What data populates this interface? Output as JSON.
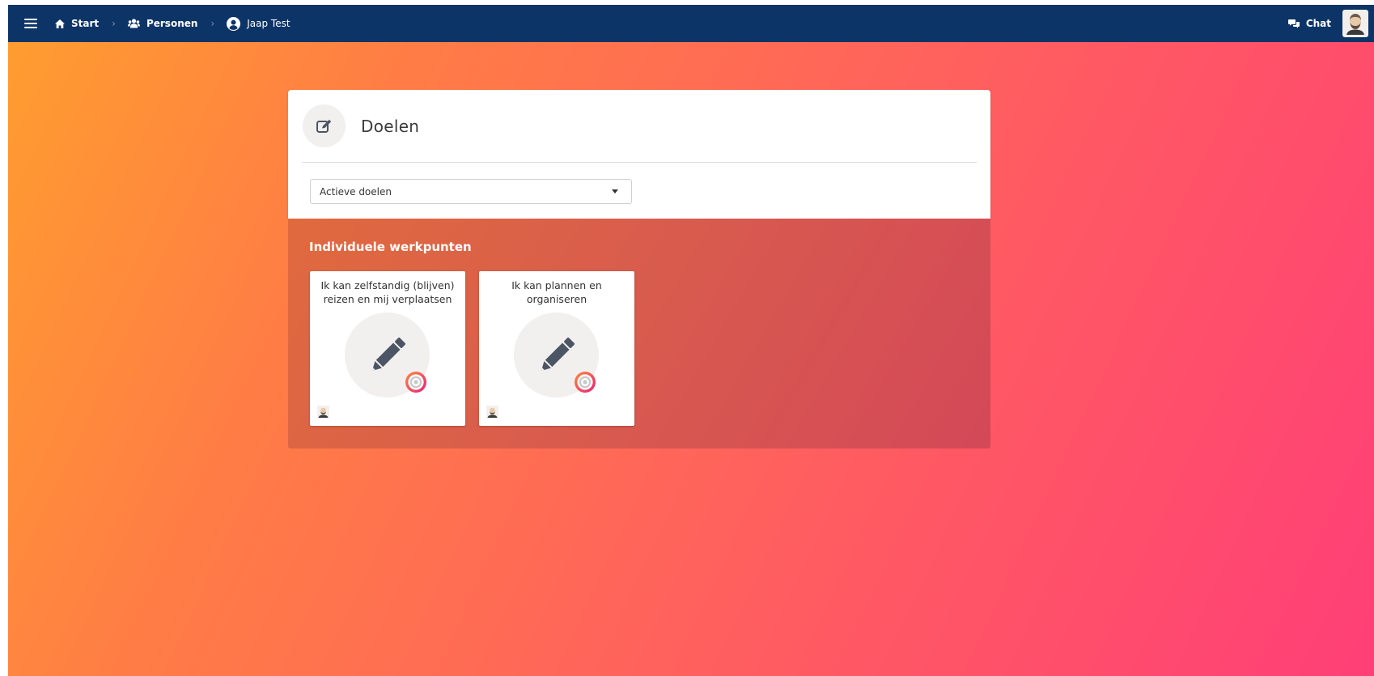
{
  "topbar": {
    "menu_icon": "hamburger-icon",
    "breadcrumb": [
      {
        "label": "Start",
        "icon": "home-icon"
      },
      {
        "label": "Personen",
        "icon": "users-icon"
      },
      {
        "label": "Jaap Test",
        "icon": "user-circle-icon"
      }
    ],
    "separator": "›",
    "chat_label": "Chat",
    "chat_icon": "chat-icon",
    "avatar_icon": "avatar-icon"
  },
  "panel": {
    "title": "Doelen",
    "icon": "edit-icon",
    "filter": {
      "selected": "Actieve doelen"
    }
  },
  "section": {
    "title": "Individuele werkpunten",
    "cards": [
      {
        "title": "Ik kan zelfstandig (blijven) reizen en mij verplaatsen",
        "icon": "pencil-icon",
        "badge_icon": "target-icon"
      },
      {
        "title": "Ik kan plannen en organiseren",
        "icon": "pencil-icon",
        "badge_icon": "target-icon"
      }
    ]
  },
  "colors": {
    "topbar": "#0d3467",
    "gradient_start": "#ff9e2f",
    "gradient_end": "#ff3f77",
    "icon_dark": "#4b5563"
  }
}
